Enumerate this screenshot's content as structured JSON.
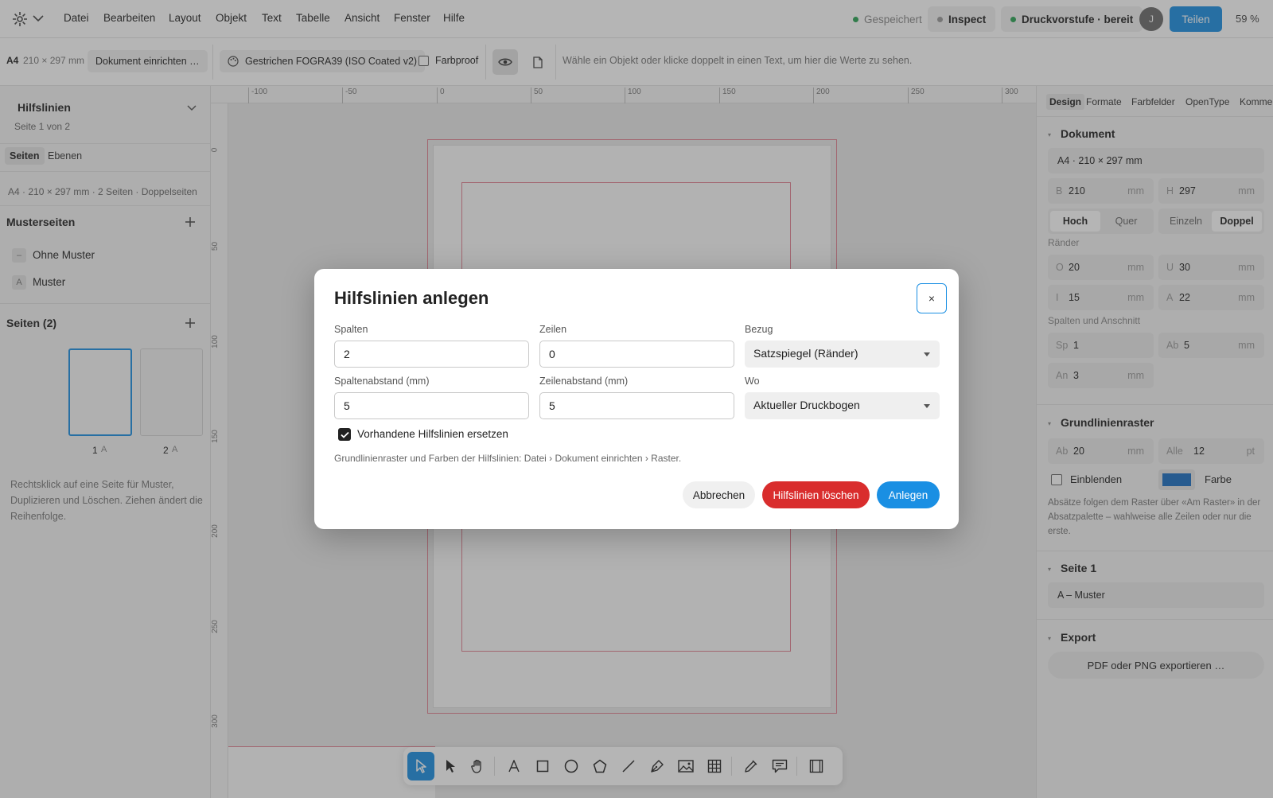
{
  "menubar": {
    "items": [
      "Datei",
      "Bearbeiten",
      "Layout",
      "Objekt",
      "Text",
      "Tabelle",
      "Ansicht",
      "Fenster",
      "Hilfe"
    ],
    "saved": "Gespeichert",
    "inspect": "Inspect",
    "preflight": "Druckvorstufe · bereit",
    "avatar": "J",
    "share": "Teilen",
    "zoom": "59 %"
  },
  "toolbar": {
    "page_size_label": "A4",
    "page_size_value": "210 × 297 mm",
    "doc_setup": "Dokument einrichten …",
    "color_profile": "Gestrichen FOGRA39 (ISO Coated v2)",
    "farbproof": "Farbproof",
    "hint": "Wähle ein Objekt oder klicke doppelt in einen Text, um hier die Werte zu sehen."
  },
  "left": {
    "title": "Hilfslinien",
    "subtitle": "Seite 1 von 2",
    "tabs": [
      "Seiten",
      "Ebenen"
    ],
    "doc_info": "A4 · 210 × 297 mm · 2 Seiten · Doppelseiten",
    "master_title": "Musterseiten",
    "masters": [
      {
        "badge": "–",
        "label": "Ohne Muster"
      },
      {
        "badge": "A",
        "label": "Muster"
      }
    ],
    "pages_title": "Seiten (2)",
    "pages": [
      {
        "num": "1",
        "master": "A"
      },
      {
        "num": "2",
        "master": "A"
      }
    ],
    "help": "Rechtsklick auf eine Seite für Muster, Duplizieren und Löschen. Ziehen ändert die Reihenfolge."
  },
  "ruler": {
    "h": [
      "-100",
      "-50",
      "0",
      "50",
      "100",
      "150",
      "200",
      "250",
      "300"
    ],
    "v": [
      "0",
      "50",
      "100",
      "150",
      "200",
      "250",
      "300"
    ]
  },
  "right": {
    "tabs": [
      "Design",
      "Formate",
      "Farbfelder",
      "OpenType",
      "Komme"
    ],
    "dokument": {
      "title": "Dokument",
      "format": "A4 · 210 × 297 mm",
      "b_label": "B",
      "b_value": "210",
      "h_label": "H",
      "h_value": "297",
      "unit": "mm",
      "orient": [
        "Hoch",
        "Quer"
      ],
      "pages": [
        "Einzeln",
        "Doppel"
      ],
      "margins_title": "Ränder",
      "o_label": "O",
      "o_value": "20",
      "u_label": "U",
      "u_value": "30",
      "i_label": "I",
      "i_value": "15",
      "a_label": "A",
      "a_value": "22",
      "cols_title": "Spalten und Anschnitt",
      "sp_label": "Sp",
      "sp_value": "1",
      "ab_label": "Ab",
      "ab_value": "5",
      "an_label": "An",
      "an_value": "3"
    },
    "grid": {
      "title": "Grundlinienraster",
      "ab_label": "Ab",
      "ab_value": "20",
      "ab_unit": "mm",
      "alle_label": "Alle",
      "alle_value": "12",
      "alle_unit": "pt",
      "show": "Einblenden",
      "color_label": "Farbe",
      "color": "#1b6fc2",
      "note": "Absätze folgen dem Raster über «Am Raster» in der Absatzpalette – wahlweise alle Zeilen oder nur die erste."
    },
    "page1": {
      "title": "Seite 1",
      "master": "A – Muster"
    },
    "export": {
      "title": "Export",
      "button": "PDF oder PNG exportieren …"
    }
  },
  "dialog": {
    "title": "Hilfslinien anlegen",
    "close": "×",
    "spalten_label": "Spalten",
    "spalten_value": "2",
    "zeilen_label": "Zeilen",
    "zeilen_value": "0",
    "bezug_label": "Bezug",
    "bezug_value": "Satzspiegel (Ränder)",
    "spaltenabstand_label": "Spaltenabstand (mm)",
    "spaltenabstand_value": "5",
    "zeilenabstand_label": "Zeilenabstand (mm)",
    "zeilenabstand_value": "5",
    "wo_label": "Wo",
    "wo_value": "Aktueller Druckbogen",
    "replace_label": "Vorhandene Hilfslinien ersetzen",
    "replace_checked": true,
    "note": "Grundlinienraster und Farben der Hilfslinien: Datei › Dokument einrichten › Raster.",
    "cancel": "Abbrechen",
    "delete": "Hilfslinien löschen",
    "create": "Anlegen"
  },
  "colors": {
    "accent": "#1a8fe3",
    "danger": "#d92d2d",
    "status_green": "#2aa454",
    "margin_guide": "#e08090"
  }
}
